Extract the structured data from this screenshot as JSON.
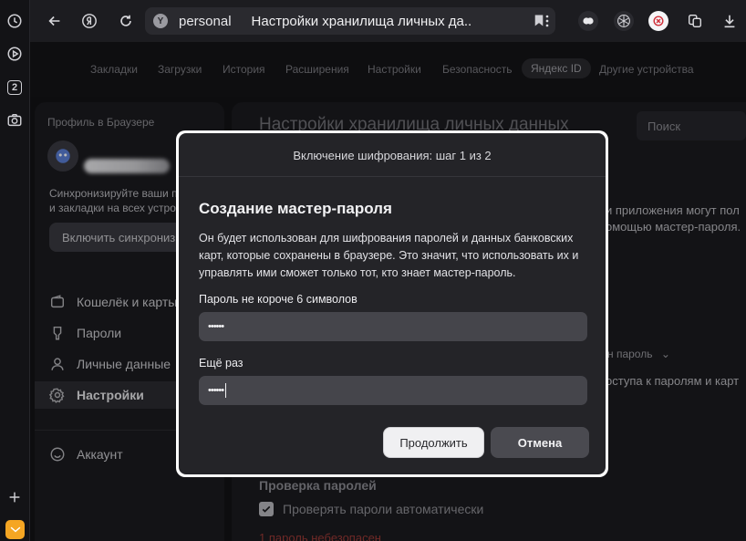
{
  "browser": {
    "address_site": "personal",
    "address_title": "Настройки хранилища личных да...",
    "tab_count": "2"
  },
  "settings_nav": {
    "items": [
      "Закладки",
      "Загрузки",
      "История",
      "Расширения",
      "Настройки",
      "Безопасность",
      "Яндекс ID",
      "Другие устройства"
    ],
    "active": "Яндекс ID"
  },
  "sidebar": {
    "profile_header": "Профиль в Браузере",
    "sync_text_1": "Синхронизируйте ваши п",
    "sync_text_2": "и закладки на всех устро",
    "sync_button": "Включить синхрониз",
    "items": [
      {
        "label": "Кошелёк и карты",
        "icon": "wallet-icon"
      },
      {
        "label": "Пароли",
        "icon": "key-icon"
      },
      {
        "label": "Личные данные",
        "icon": "person-icon"
      },
      {
        "label": "Настройки",
        "icon": "gear-icon"
      }
    ],
    "account": "Аккаунт",
    "active": "Настройки"
  },
  "main": {
    "title": "Настройки хранилища личных данных",
    "search_placeholder": "Поиск",
    "bg_line_1": "и приложения могут пол",
    "bg_line_2": "омощью мастер-пароля.",
    "bg_dropdown": "н пароль",
    "bg_line_3": "оступа к паролям и карт",
    "check_title": "Проверка паролей",
    "check_label": "Проверять пароли автоматически",
    "check_checked": true,
    "unsafe_link": "1 пароль небезопасен"
  },
  "modal": {
    "step": "Включение шифрования: шаг 1 из 2",
    "heading": "Создание мастер-пароля",
    "description": "Он будет использован для шифрования паролей и данных банковских карт, которые сохранены в браузере. Это значит, что использовать их и управлять ими сможет только тот, кто знает мастер-пароль.",
    "field1_label": "Пароль не короче 6 символов",
    "field1_value": "••••••",
    "field2_label": "Ещё раз",
    "field2_value": "••••••",
    "continue_button": "Продолжить",
    "cancel_button": "Отмена"
  },
  "colors": {
    "background": "#121215",
    "modal_bg": "#242428",
    "modal_border": "#ffffff",
    "field_bg": "#45454b",
    "primary_button": "#f0f0f2",
    "secondary_button": "#4a4a50",
    "unsafe": "#9b3a36"
  }
}
